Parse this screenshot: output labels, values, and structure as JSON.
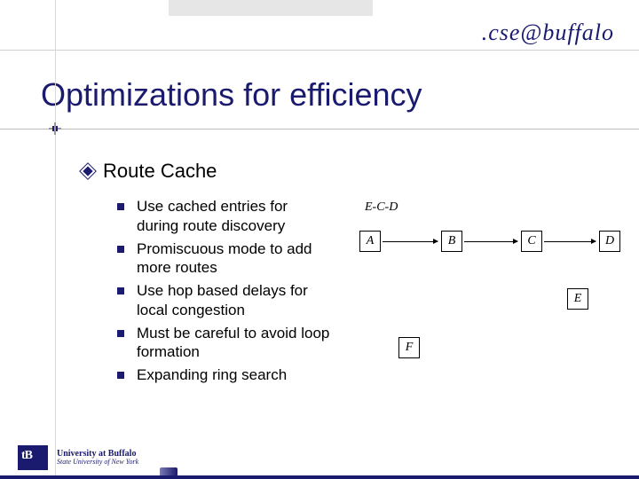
{
  "header": {
    "cse_logo": ".cse@buffalo",
    "title": "Optimizations for efficiency"
  },
  "section": {
    "heading": "Route Cache",
    "items": [
      "Use cached entries for during route discovery",
      "Promiscuous mode to add more routes",
      "Use hop based delays for local congestion",
      "Must be careful to avoid loop formation",
      "Expanding ring search"
    ]
  },
  "diagram": {
    "path_label": "E-C-D",
    "nodes": {
      "A": "A",
      "B": "B",
      "C": "C",
      "D": "D",
      "E": "E",
      "F": "F"
    }
  },
  "footer": {
    "ub_short": "B",
    "line1": "University at Buffalo",
    "line2": "State University of New York"
  }
}
